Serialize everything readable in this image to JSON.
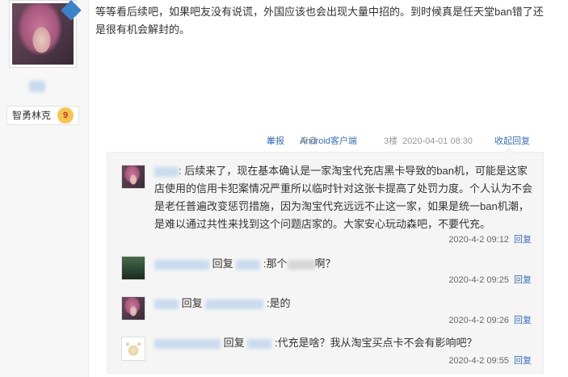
{
  "sidebar": {
    "user_title": "智勇林克",
    "level": "9"
  },
  "post": {
    "body": "等等看后续吧，如果吧友没有说谎，外国应该也会出现大量中招的。到时候真是任天堂ban错了还是很有机会解封的。"
  },
  "meta": {
    "report": "举报",
    "device_prefix": "来自",
    "device_link": "Android客户端",
    "floor": "3楼",
    "date": "2020-04-01 08:30",
    "collapse": "收起回复"
  },
  "replies": [
    {
      "content": "后续来了，现在基本确认是一家淘宝代充店黑卡导致的ban机，可能是这家店使用的信用卡犯案情况严重所以临时针对这张卡提高了处罚力度。个人认为不会是老任普遍改变惩罚措施，因为淘宝代充远远不止这一家，如果是统一ban机潮，是难以通过共性来找到这个问题店家的。大家安心玩动森吧，不要代充。",
      "time": "2020-4-2 09:12",
      "reply_label": "回复"
    },
    {
      "reply_word": "回复",
      "content_a": ":那个",
      "content_b": "啊？",
      "time": "2020-4-2 09:25",
      "reply_label": "回复"
    },
    {
      "reply_word": "回复",
      "content": ":是的",
      "time": "2020-4-2 09:26",
      "reply_label": "回复"
    },
    {
      "reply_word": "回复",
      "content": ":代充是啥？我从淘宝买点卡不会有影响吧？",
      "time": "2020-4-2 09:55",
      "reply_label": "回复"
    }
  ],
  "colors": {
    "link": "#3c6fb3",
    "reply_bg": "#f5f5f5",
    "meta_text": "#999999"
  }
}
